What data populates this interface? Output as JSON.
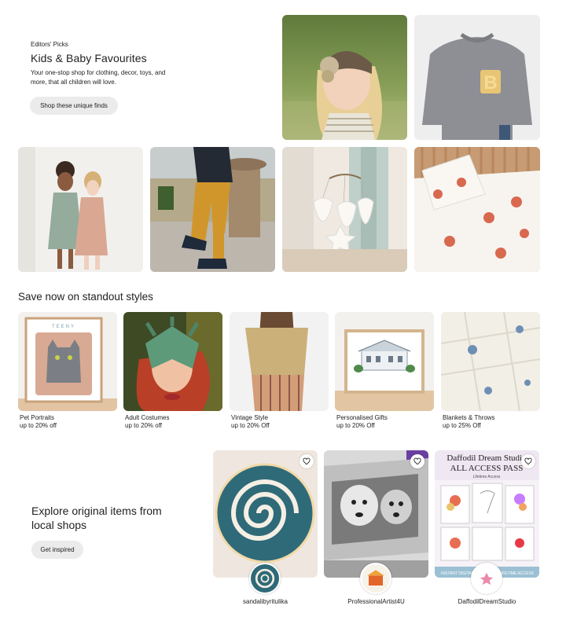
{
  "hero": {
    "eyebrow": "Editors' Picks",
    "title": "Kids & Baby Favourites",
    "description": "Your one-stop shop for clothing, decor, toys, and more, that all children will love.",
    "cta_label": "Shop these unique finds",
    "images": [
      "girl-knit-headband-photo",
      "toddler-grey-b-sweater-photo",
      "two-girls-dresses-photo",
      "child-mustard-pants-photo",
      "seashell-mobile-nursery-photo",
      "sun-print-bedding-photo"
    ]
  },
  "deals": {
    "title": "Save now on standout styles",
    "items": [
      {
        "name": "Pet Portraits",
        "discount": "up to 20% off"
      },
      {
        "name": "Adult Costumes",
        "discount": "up to 20% off"
      },
      {
        "name": "Vintage Style",
        "discount": "up to 20% Off"
      },
      {
        "name": "Personalised Gifts",
        "discount": "up to 20% Off"
      },
      {
        "name": "Blankets & Throws",
        "discount": "up to 25% Off"
      }
    ]
  },
  "explore": {
    "title": "Explore original items from local shops",
    "cta_label": "Get inspired",
    "shops": [
      {
        "name": "sandalibyritulika",
        "favorite_icon": "heart-icon"
      },
      {
        "name": "ProfessionalArtist4U",
        "favorite_icon": "heart-icon"
      },
      {
        "name": "DaffodilDreamStudio",
        "favorite_icon": "heart-icon",
        "image_text": {
          "line1": "Daffodil Dream Studio",
          "line2": "ALL ACCESS PASS",
          "line3": "Lifetime Access",
          "line4": "INSTANT DIGITAL DOWNLOAD",
          "line5": "LIFETIME ACCESS"
        }
      }
    ]
  },
  "colors": {
    "button_bg": "#ebebeb",
    "text": "#222222"
  }
}
